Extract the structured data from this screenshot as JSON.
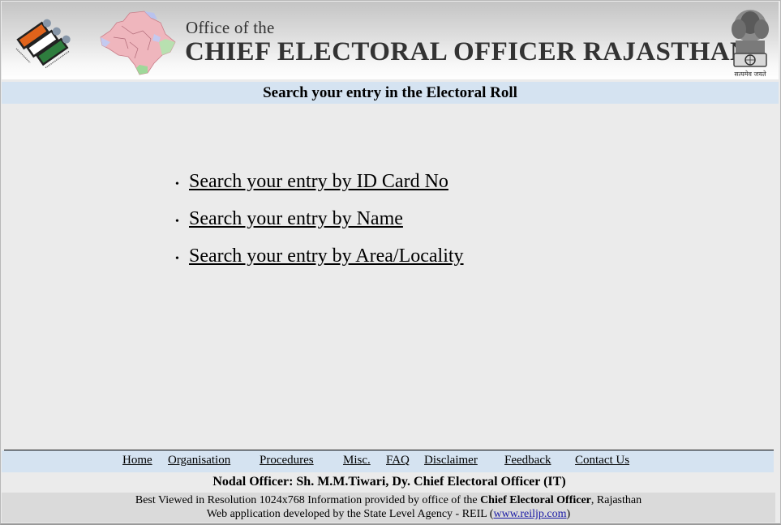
{
  "header": {
    "office_of": "Office of the",
    "title": "CHIEF ELECTORAL OFFICER RAJASTHAN",
    "emblem_motto": "सत्यमेव जयते",
    "logos": [
      "election-commission-logo",
      "rajasthan-map-logo",
      "national-emblem"
    ]
  },
  "page_title": "Search your entry in the Electoral Roll",
  "search_links": [
    {
      "label": "Search your entry by ID Card No"
    },
    {
      "label": "Search your entry by Name"
    },
    {
      "label": "Search your entry by Area/Locality"
    }
  ],
  "footer": {
    "nav": [
      {
        "label": "Home"
      },
      {
        "label": "Organisation"
      },
      {
        "label": "Procedures"
      },
      {
        "label": "Misc."
      },
      {
        "label": "FAQ"
      },
      {
        "label": "Disclaimer"
      },
      {
        "label": "Feedback"
      },
      {
        "label": "Contact Us"
      }
    ],
    "nodal_officer": "Nodal Officer: Sh. M.M.Tiwari, Dy. Chief Electoral Officer (IT)",
    "info_line1_prefix": "Best Viewed in Resolution 1024x768 Information provided by office of the ",
    "info_line1_bold": "Chief Electoral Officer",
    "info_line1_suffix": ", Rajasthan",
    "info_line2_prefix": "Web application developed by the State Level Agency - REIL (",
    "info_line2_link": "www.reiljp.com",
    "info_line2_suffix": ")"
  },
  "colors": {
    "strip_blue": "#d5e3f1",
    "page_bg": "#ebebeb",
    "info_bg": "#dadada",
    "link_blue": "#1a1aa6",
    "saffron": "#e0631b",
    "green": "#2e7d3e"
  }
}
